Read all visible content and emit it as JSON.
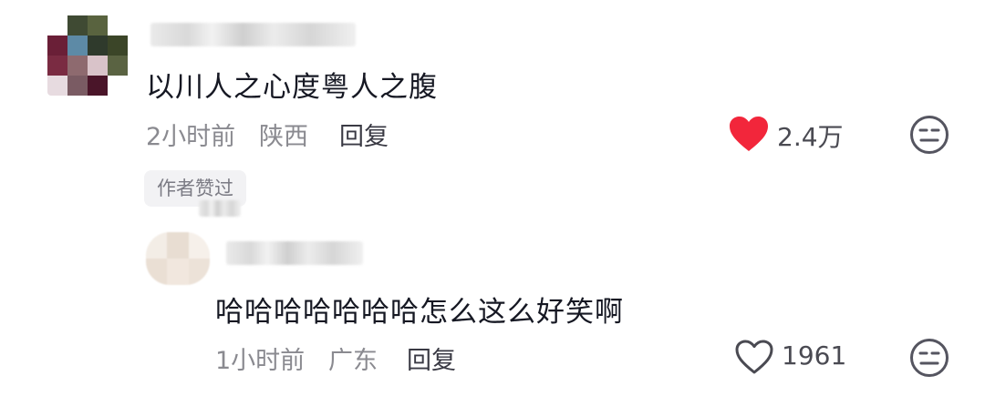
{
  "comments": [
    {
      "text": "以川人之心度粤人之腹",
      "time": "2小时前",
      "location": "陕西",
      "reply_label": "回复",
      "tag": "作者赞过",
      "likes": "2.4万",
      "liked": true
    },
    {
      "text": "哈哈哈哈哈哈哈怎么这么好笑啊",
      "time": "1小时前",
      "location": "广东",
      "reply_label": "回复",
      "likes": "1961",
      "liked": false
    }
  ],
  "colors": {
    "like_red": "#f2263b",
    "text": "#161823",
    "meta": "#8a8a90"
  },
  "icons": [
    "avatar",
    "heart-filled-icon",
    "heart-outline-icon",
    "neutral-face-icon"
  ]
}
